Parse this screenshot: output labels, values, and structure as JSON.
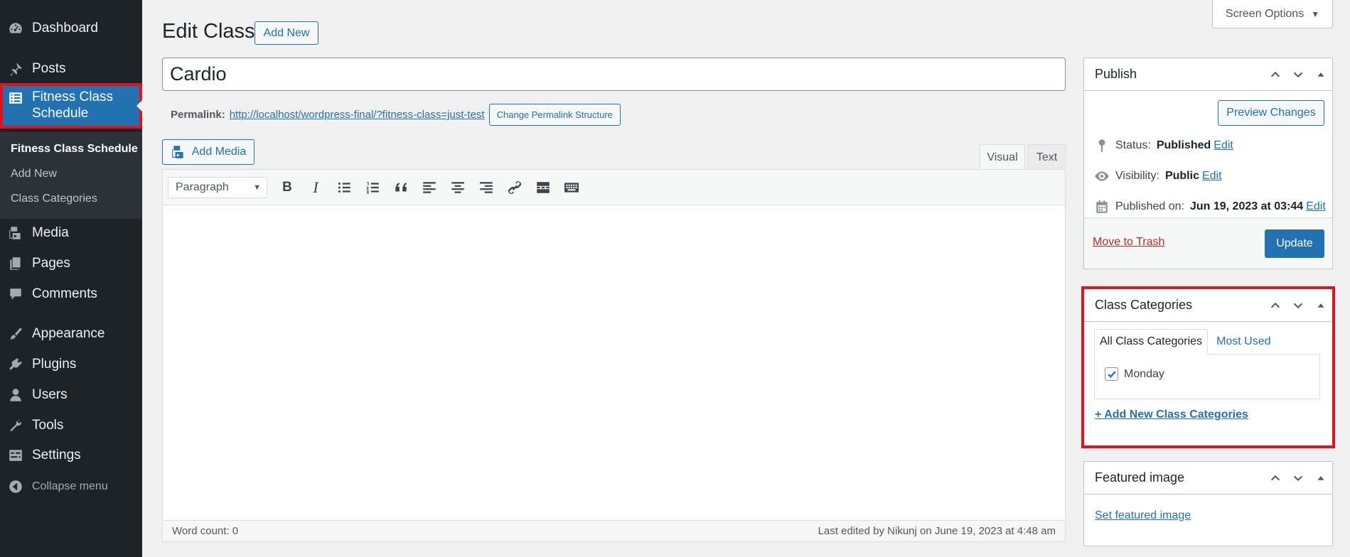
{
  "sidebar": {
    "dashboard": "Dashboard",
    "posts": "Posts",
    "fitness": "Fitness Class Schedule",
    "submenu": [
      "Fitness Class Schedule",
      "Add New",
      "Class Categories"
    ],
    "media": "Media",
    "pages": "Pages",
    "comments": "Comments",
    "appearance": "Appearance",
    "plugins": "Plugins",
    "users": "Users",
    "tools": "Tools",
    "settings": "Settings",
    "collapse": "Collapse menu"
  },
  "header": {
    "title": "Edit Class",
    "add_new": "Add New",
    "screen_options": "Screen Options"
  },
  "post": {
    "title": "Cardio",
    "permalink_label": "Permalink:",
    "permalink_url": "http://localhost/wordpress-final/?fitness-class=just-test",
    "change_permalink": "Change Permalink Structure"
  },
  "editor": {
    "add_media": "Add Media",
    "tab_visual": "Visual",
    "tab_text": "Text",
    "format": "Paragraph",
    "word_count": "Word count: 0",
    "last_edited": "Last edited by Nikunj on June 19, 2023 at 4:48 am"
  },
  "publish": {
    "title": "Publish",
    "preview": "Preview Changes",
    "status_label": "Status:",
    "status_value": "Published",
    "visibility_label": "Visibility:",
    "visibility_value": "Public",
    "published_label": "Published on:",
    "published_value": "Jun 19, 2023 at 03:44",
    "edit": "Edit",
    "trash": "Move to Trash",
    "update": "Update"
  },
  "categories": {
    "title": "Class Categories",
    "tab_all": "All Class Categories",
    "tab_most": "Most Used",
    "item": "Monday",
    "item_checked": true,
    "add_link": "+ Add New Class Categories"
  },
  "featured": {
    "title": "Featured image",
    "link": "Set featured image"
  },
  "colors": {
    "accent": "#2271b1",
    "sidebar_bg": "#1d2327",
    "highlight_outline": "#e0141e"
  }
}
